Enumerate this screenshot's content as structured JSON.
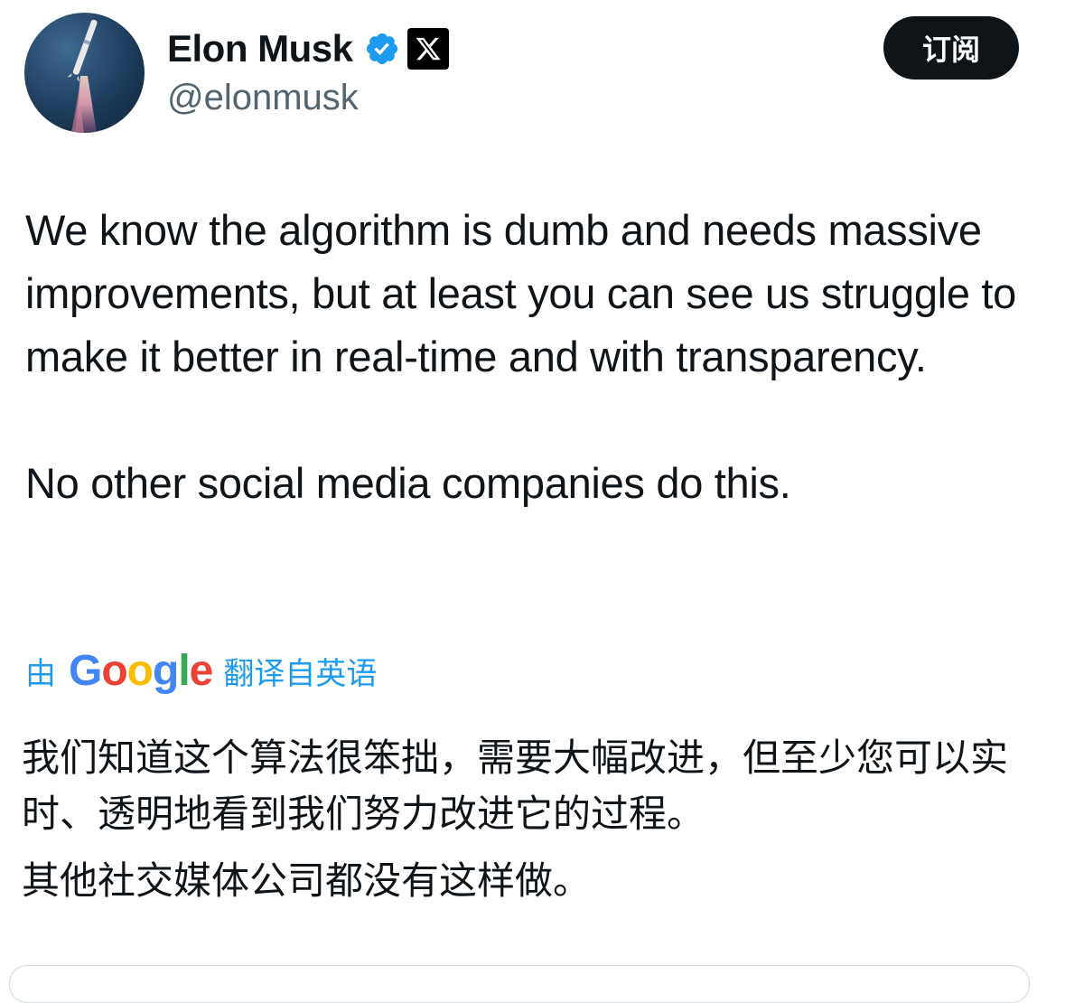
{
  "author": {
    "display_name": "Elon Musk",
    "handle": "@elonmusk",
    "avatar_icon": "rocket-launch-avatar",
    "verified_icon": "verified-badge-icon",
    "affiliation_icon": "x-logo-icon"
  },
  "header": {
    "subscribe_label": "订阅"
  },
  "tweet": {
    "paragraphs": [
      "We know the algorithm is dumb and needs massive improvements, but at least you can see us struggle to make it better in real-time and with transparency.",
      "No other social media companies do this."
    ]
  },
  "translation": {
    "prefix": "由",
    "provider_letters": [
      "G",
      "o",
      "o",
      "g",
      "l",
      "e"
    ],
    "suffix": "翻译自英语",
    "paragraphs": [
      "我们知道这个算法很笨拙，需要大幅改进，但至少您可以实时、透明地看到我们努力改进它的过程。",
      "其他社交媒体公司都没有这样做。"
    ]
  },
  "colors": {
    "link_blue": "#1d9bf0",
    "text_primary": "#0f1419",
    "text_secondary": "#536471",
    "verified_blue": "#1d9bf0"
  }
}
